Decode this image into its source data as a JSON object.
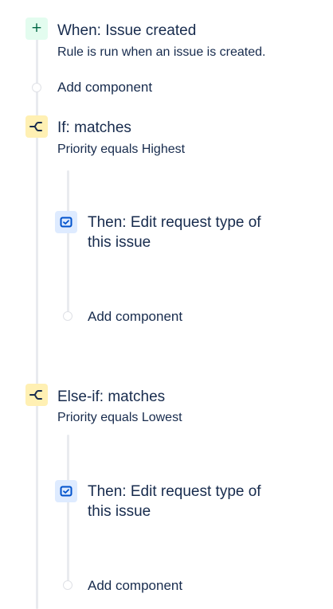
{
  "trigger": {
    "icon": "plus-icon",
    "title": "When: Issue created",
    "description": "Rule is run when an issue is created."
  },
  "add_component_1": {
    "label": "Add component"
  },
  "condition_if": {
    "icon": "branch-icon",
    "title": "If: matches",
    "description": "Priority equals Highest",
    "action": {
      "icon": "request-type-icon",
      "title": "Then: Edit request type of this issue"
    },
    "add_component": {
      "label": "Add component"
    }
  },
  "condition_else_if": {
    "icon": "branch-icon",
    "title": "Else-if: matches",
    "description": "Priority equals Lowest",
    "action": {
      "icon": "request-type-icon",
      "title": "Then: Edit request type of this issue"
    },
    "add_component": {
      "label": "Add component"
    }
  },
  "colors": {
    "trigger_bg": "#E3FCEF",
    "trigger_icon": "#006644",
    "condition_bg": "#FFF0B3",
    "condition_icon": "#172B4D",
    "action_bg": "#DEEBFF",
    "action_icon": "#0052CC",
    "rail": "#E9EBEF",
    "text": "#172B4D"
  }
}
